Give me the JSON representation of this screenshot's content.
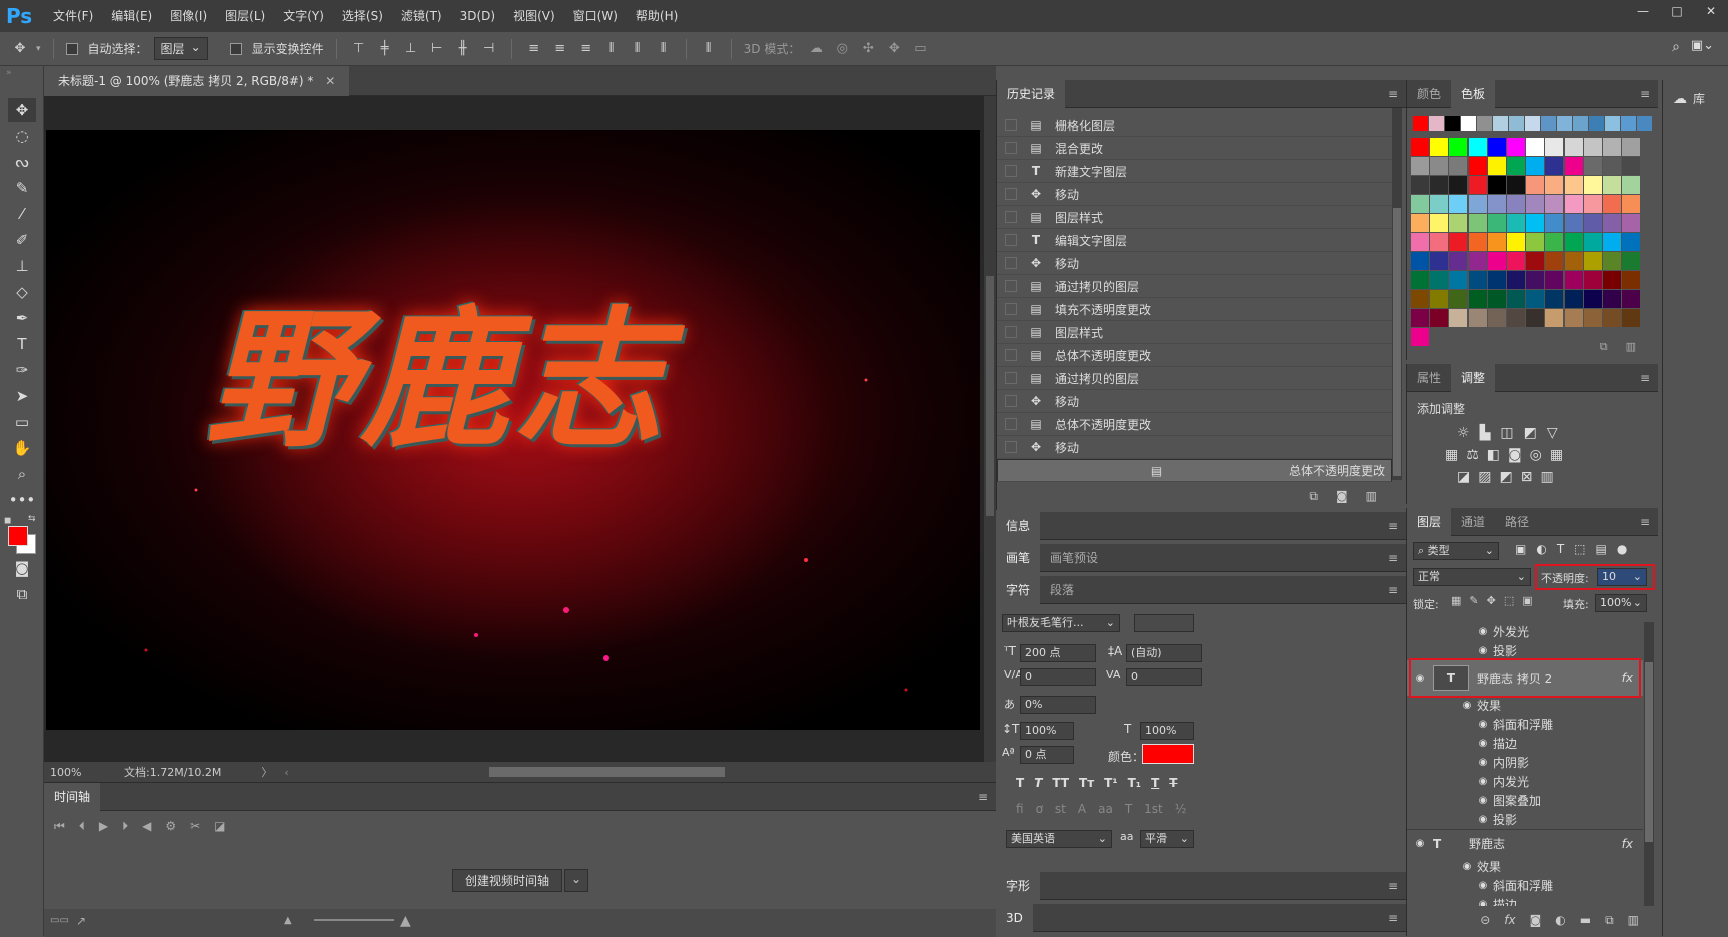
{
  "app": {
    "logo": "Ps"
  },
  "menu": [
    "文件(F)",
    "编辑(E)",
    "图像(I)",
    "图层(L)",
    "文字(Y)",
    "选择(S)",
    "滤镜(T)",
    "3D(D)",
    "视图(V)",
    "窗口(W)",
    "帮助(H)"
  ],
  "window_controls": [
    "—",
    "□",
    "✕"
  ],
  "options": {
    "auto_select_label": "自动选择：",
    "auto_select_value": "图层",
    "show_transform_label": "显示变换控件",
    "mode_3d_label": "3D 模式："
  },
  "document": {
    "tab_title": "未标题-1 @ 100% (野鹿志 拷贝 2, RGB/8#) *",
    "artwork_text": "野鹿志",
    "zoom": "100%",
    "doc_info": "文档:1.72M/10.2M"
  },
  "timeline": {
    "tab": "时间轴",
    "create_button": "创建视频时间轴"
  },
  "history": {
    "tab": "历史记录",
    "rows": [
      {
        "label": "栅格化图层",
        "icon": "doc"
      },
      {
        "label": "混合更改",
        "icon": "doc"
      },
      {
        "label": "新建文字图层",
        "icon": "T"
      },
      {
        "label": "移动",
        "icon": "move"
      },
      {
        "label": "图层样式",
        "icon": "doc"
      },
      {
        "label": "编辑文字图层",
        "icon": "T"
      },
      {
        "label": "移动",
        "icon": "move"
      },
      {
        "label": "通过拷贝的图层",
        "icon": "doc"
      },
      {
        "label": "填充不透明度更改",
        "icon": "doc"
      },
      {
        "label": "图层样式",
        "icon": "doc"
      },
      {
        "label": "总体不透明度更改",
        "icon": "doc"
      },
      {
        "label": "通过拷贝的图层",
        "icon": "doc"
      },
      {
        "label": "移动",
        "icon": "move"
      },
      {
        "label": "总体不透明度更改",
        "icon": "doc"
      },
      {
        "label": "移动",
        "icon": "move"
      },
      {
        "label": "总体不透明度更改",
        "icon": "doc",
        "selected": true
      }
    ]
  },
  "info": {
    "tab": "信息"
  },
  "brush": {
    "tab1": "画笔",
    "tab2": "画笔预设"
  },
  "character": {
    "tab1": "字符",
    "tab2": "段落",
    "font": "叶根友毛笔行...",
    "size": "200 点",
    "leading": "(自动)",
    "kerning": "0",
    "tracking": "0",
    "scale_pct": "0%",
    "vscale": "100%",
    "hscale": "100%",
    "baseline": "0 点",
    "color_label": "颜色：",
    "color_value": "#ff0000",
    "language": "美国英语",
    "aa_label": "aa",
    "antialias": "平滑"
  },
  "glyph": {
    "tab": "字形"
  },
  "threed": {
    "tab": "3D"
  },
  "color_panel": {
    "tab1": "颜色",
    "tab2": "色板"
  },
  "swatches_row1": [
    "#ff0000",
    "#e5b6c8",
    "#000000",
    "#ffffff",
    "#909090",
    "#b0cfe0",
    "#8fbcd4",
    "#c6d9ec",
    "#5e94c6",
    "#7fb3d9",
    "#6aa3cc",
    "#3d7fb5",
    "#8cc0e0",
    "#5a9cd1",
    "#4a88c0"
  ],
  "swatches": [
    "#ff0000",
    "#ffff00",
    "#00ff00",
    "#00ffff",
    "#0000ff",
    "#ff00ff",
    "#ffffff",
    "#e8e8e8",
    "#d6d6d6",
    "#c4c4c4",
    "#b2b2b2",
    "#a0a0a0",
    "#9a9a9a",
    "#8a8a8a",
    "#7a7a7a",
    "#ff0000",
    "#fff200",
    "#00a651",
    "#00aeef",
    "#2e3192",
    "#ec008c",
    "#6a6a6a",
    "#5a5a5a",
    "#4a4a4a",
    "#3a3a3a",
    "#2a2a2a",
    "#1a1a1a",
    "#ed1c24",
    "#000000",
    "#111111",
    "#f7977a",
    "#f9ad81",
    "#fdc68a",
    "#fff79a",
    "#c4df9b",
    "#a3d39c",
    "#82ca9d",
    "#7bcdc8",
    "#6ecff6",
    "#7ea7d8",
    "#8493ca",
    "#8882be",
    "#a187be",
    "#bc8dbf",
    "#f49ac2",
    "#f6989d",
    "#f26c4f",
    "#f68e55",
    "#fbaf5c",
    "#fff467",
    "#acd372",
    "#7cc576",
    "#3bb878",
    "#1abbb4",
    "#00bff3",
    "#438ccb",
    "#5574b9",
    "#605ca8",
    "#855fa8",
    "#a763a8",
    "#f06ea9",
    "#f26d7d",
    "#ed1c24",
    "#f26522",
    "#f7941d",
    "#fff200",
    "#8dc73f",
    "#39b54a",
    "#00a651",
    "#00a99d",
    "#00aeef",
    "#0072bc",
    "#0054a6",
    "#2e3192",
    "#662d91",
    "#92278f",
    "#ec008c",
    "#ed145b",
    "#9e0b0f",
    "#a0410d",
    "#a36209",
    "#aba000",
    "#598527",
    "#1a7b30",
    "#007236",
    "#00746b",
    "#0076a3",
    "#004b80",
    "#003471",
    "#1b1464",
    "#440e62",
    "#630460",
    "#9e005d",
    "#9e0039",
    "#790000",
    "#7b2e00",
    "#7d4900",
    "#827b00",
    "#406618",
    "#005e20",
    "#005826",
    "#005952",
    "#005b7f",
    "#003663",
    "#002157",
    "#0d004c",
    "#32004b",
    "#4b0049",
    "#7b0046",
    "#7a0026",
    "#c7b299",
    "#998675",
    "#736357",
    "#534741",
    "#37302d",
    "#c69c6d",
    "#a67c52",
    "#8c6239",
    "#754c24",
    "#603913",
    "#ec008c"
  ],
  "adjust_panel": {
    "tab1": "属性",
    "tab2": "调整",
    "title": "添加调整"
  },
  "layers_panel": {
    "tab1": "图层",
    "tab2": "通道",
    "tab3": "路径",
    "filter_label": "类型",
    "blend_mode": "正常",
    "opacity_label": "不透明度:",
    "opacity_value": "10",
    "lock_label": "锁定:",
    "fill_label": "填充:",
    "fill_value": "100%",
    "rows_top": [
      {
        "label": "外发光",
        "level": 2
      },
      {
        "label": "投影",
        "level": 2
      }
    ],
    "selected_layer": "野鹿志 拷贝 2",
    "effects_label": "效果",
    "effects_rows": [
      "斜面和浮雕",
      "描边",
      "内阴影",
      "内发光",
      "图案叠加",
      "投影"
    ],
    "layer2": "野鹿志",
    "layer2_effects_label": "效果",
    "layer2_rows": [
      "斜面和浮雕",
      "描边"
    ],
    "fx": "fx"
  },
  "library": {
    "label": "库"
  }
}
